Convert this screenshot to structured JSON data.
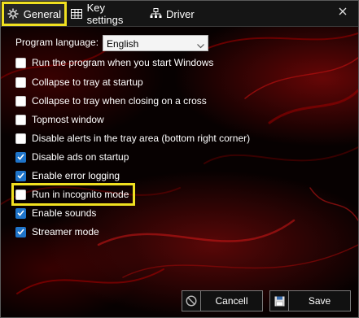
{
  "tabs": [
    {
      "label": "General",
      "icon": "gear-icon",
      "active": true
    },
    {
      "label": "Key settings",
      "icon": "keyboard-icon",
      "active": false
    },
    {
      "label": "Driver",
      "icon": "network-icon",
      "active": false
    }
  ],
  "window": {
    "close_icon": "close-icon"
  },
  "language": {
    "label": "Program language:",
    "value": "English"
  },
  "options": [
    {
      "label": "Run the program when you start Windows",
      "checked": false
    },
    {
      "label": "Collapse to tray at startup",
      "checked": false
    },
    {
      "label": "Collapse to tray when closing on a cross",
      "checked": false
    },
    {
      "label": "Topmost window",
      "checked": false
    },
    {
      "label": "Disable alerts in the tray area (bottom right corner)",
      "checked": false
    },
    {
      "label": "Disable ads on startup",
      "checked": true
    },
    {
      "label": "Enable error logging",
      "checked": true
    },
    {
      "label": "Run in incognito mode",
      "checked": false
    },
    {
      "label": "Enable sounds",
      "checked": true
    },
    {
      "label": "Streamer mode",
      "checked": true
    }
  ],
  "buttons": {
    "cancel": "Cancell",
    "save": "Save"
  },
  "colors": {
    "checkbox_checked": "#1f74c9",
    "highlight": "#f0e020",
    "accent_red": "#b40a0a"
  }
}
